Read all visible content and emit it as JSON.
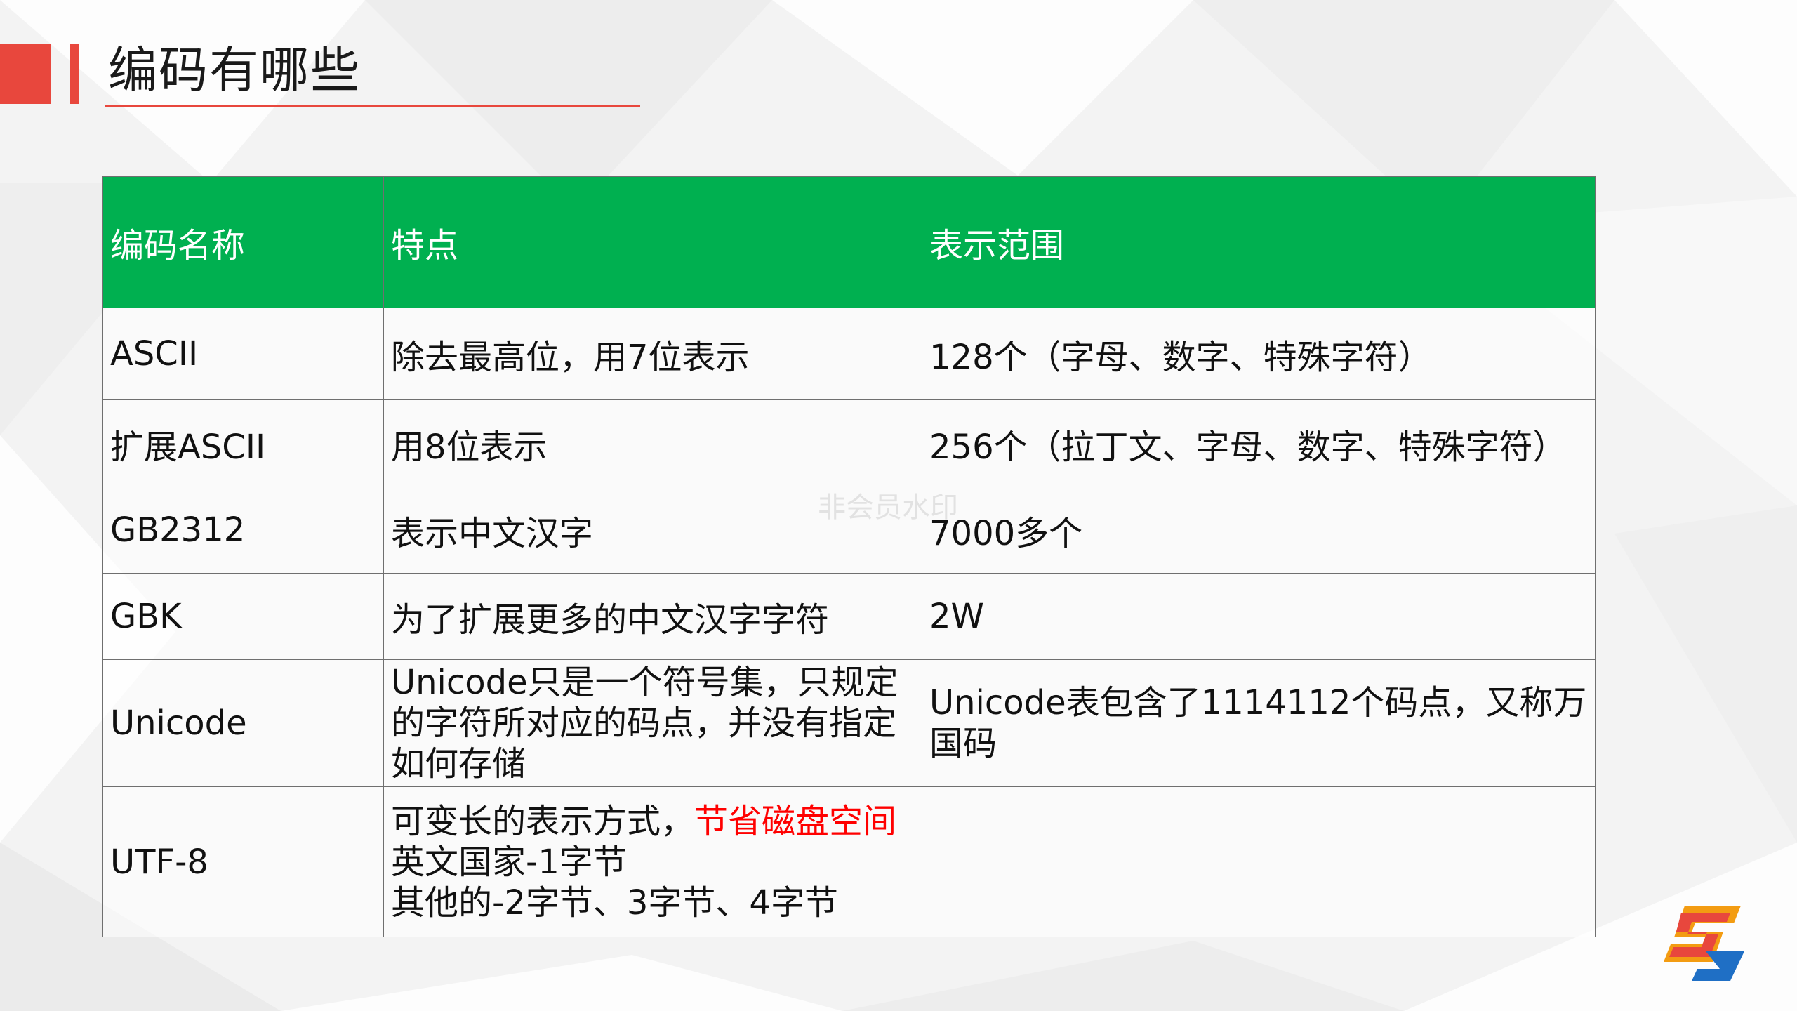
{
  "slide": {
    "title": "编码有哪些",
    "watermark": "非会员水印",
    "accent_color": "#e8473d",
    "header_color": "#00b050"
  },
  "table": {
    "headers": [
      "编码名称",
      "特点",
      "表示范围"
    ],
    "rows": [
      {
        "name": "ASCII",
        "feature": [
          "除去最高位，用7位表示"
        ],
        "range": [
          "128个（字母、数字、特殊字符）"
        ]
      },
      {
        "name": "扩展ASCII",
        "feature": [
          "用8位表示"
        ],
        "range": [
          "256个（拉丁文、字母、数字、特殊字符）"
        ]
      },
      {
        "name": "GB2312",
        "feature": [
          "表示中文汉字"
        ],
        "range": [
          "7000多个"
        ]
      },
      {
        "name": "GBK",
        "feature": [
          "为了扩展更多的中文汉字字符"
        ],
        "range": [
          "2W"
        ]
      },
      {
        "name": "Unicode",
        "feature": [
          "Unicode只是一个符号集，只规定",
          "的字符所对应的码点，并没有指定",
          "如何存储"
        ],
        "range": [
          "Unicode表包含了1114112个码点，又称万",
          "国码"
        ]
      },
      {
        "name": "UTF-8",
        "feature_first": "可变长的表示方式，",
        "feature_highlight": "节省磁盘空间",
        "feature": [
          "英文国家-1字节",
          "其他的-2字节、3字节、4字节"
        ],
        "range": []
      }
    ]
  },
  "logo": {
    "icon": "brand-s-logo"
  }
}
